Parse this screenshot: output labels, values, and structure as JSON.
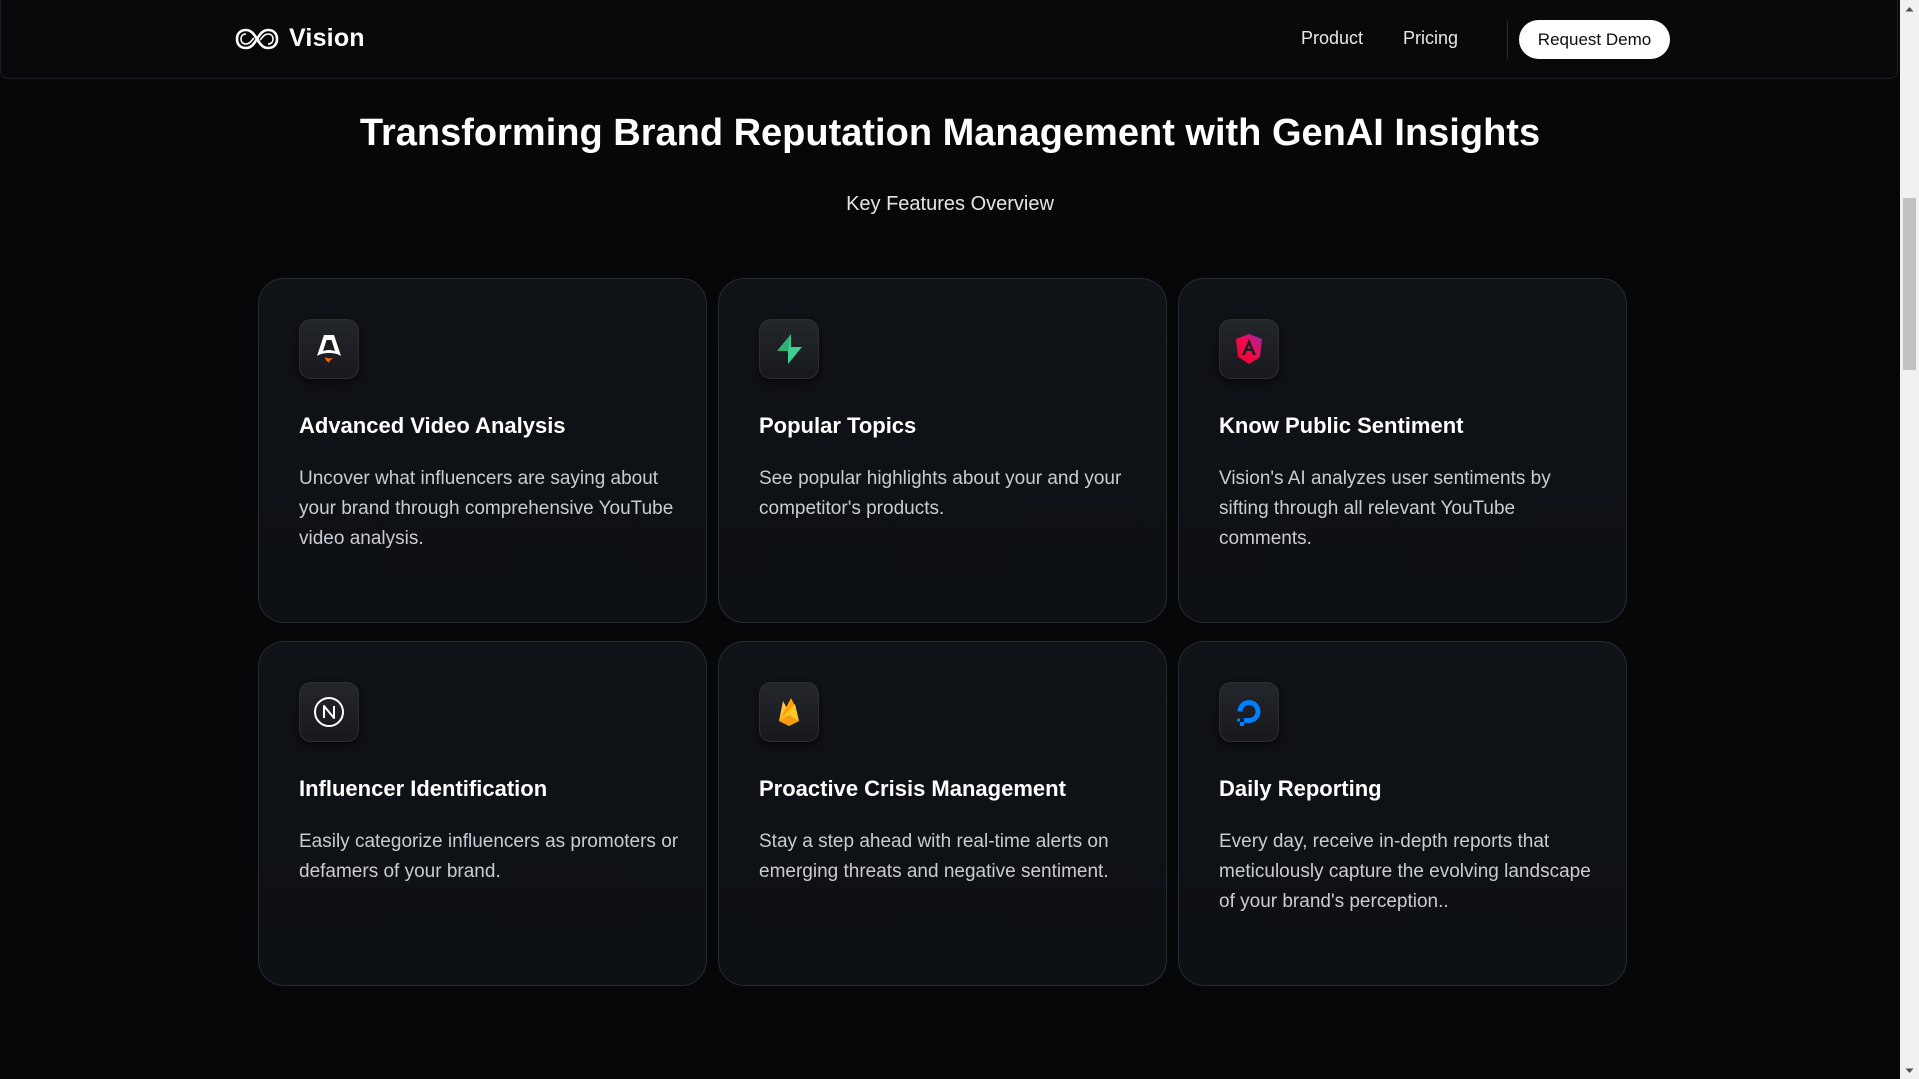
{
  "nav": {
    "brand": "Vision",
    "links": [
      "Product",
      "Pricing"
    ],
    "cta": "Request Demo"
  },
  "hero": {
    "title": "Transforming Brand Reputation Management with GenAI Insights",
    "subtitle": "Key Features Overview"
  },
  "features": [
    {
      "icon": "astro-logo-icon",
      "title": "Advanced Video Analysis",
      "description": "Uncover what influencers are saying about your brand through comprehensive YouTube video analysis."
    },
    {
      "icon": "lightning-bolt-icon",
      "title": "Popular Topics",
      "description": "See popular highlights about your and your competitor's products."
    },
    {
      "icon": "angular-logo-icon",
      "title": "Know Public Sentiment",
      "description": "Vision's AI analyzes user sentiments by sifting through all relevant YouTube comments."
    },
    {
      "icon": "nextjs-logo-icon",
      "title": "Influencer Identification",
      "description": "Easily categorize influencers as promoters or defamers of your brand."
    },
    {
      "icon": "firebase-flame-icon",
      "title": "Proactive Crisis Management",
      "description": "Stay a step ahead with real-time alerts on emerging threats and negative sentiment."
    },
    {
      "icon": "digitalocean-logo-icon",
      "title": "Daily Reporting",
      "description": "Every day, receive in-depth reports that meticulously capture the evolving landscape of your brand's perception.."
    }
  ],
  "colors": {
    "background": "#060708",
    "card_background": "#0f1216",
    "card_border": "#262a31",
    "bolt_green": "#3ecf8e",
    "flame_orange": "#ffa000",
    "flame_yellow": "#ffca28",
    "angular_pink": "#e40035",
    "angular_purple": "#9c27b0",
    "digitalocean_blue": "#0080ff",
    "astro_orange": "#ff5d01"
  }
}
